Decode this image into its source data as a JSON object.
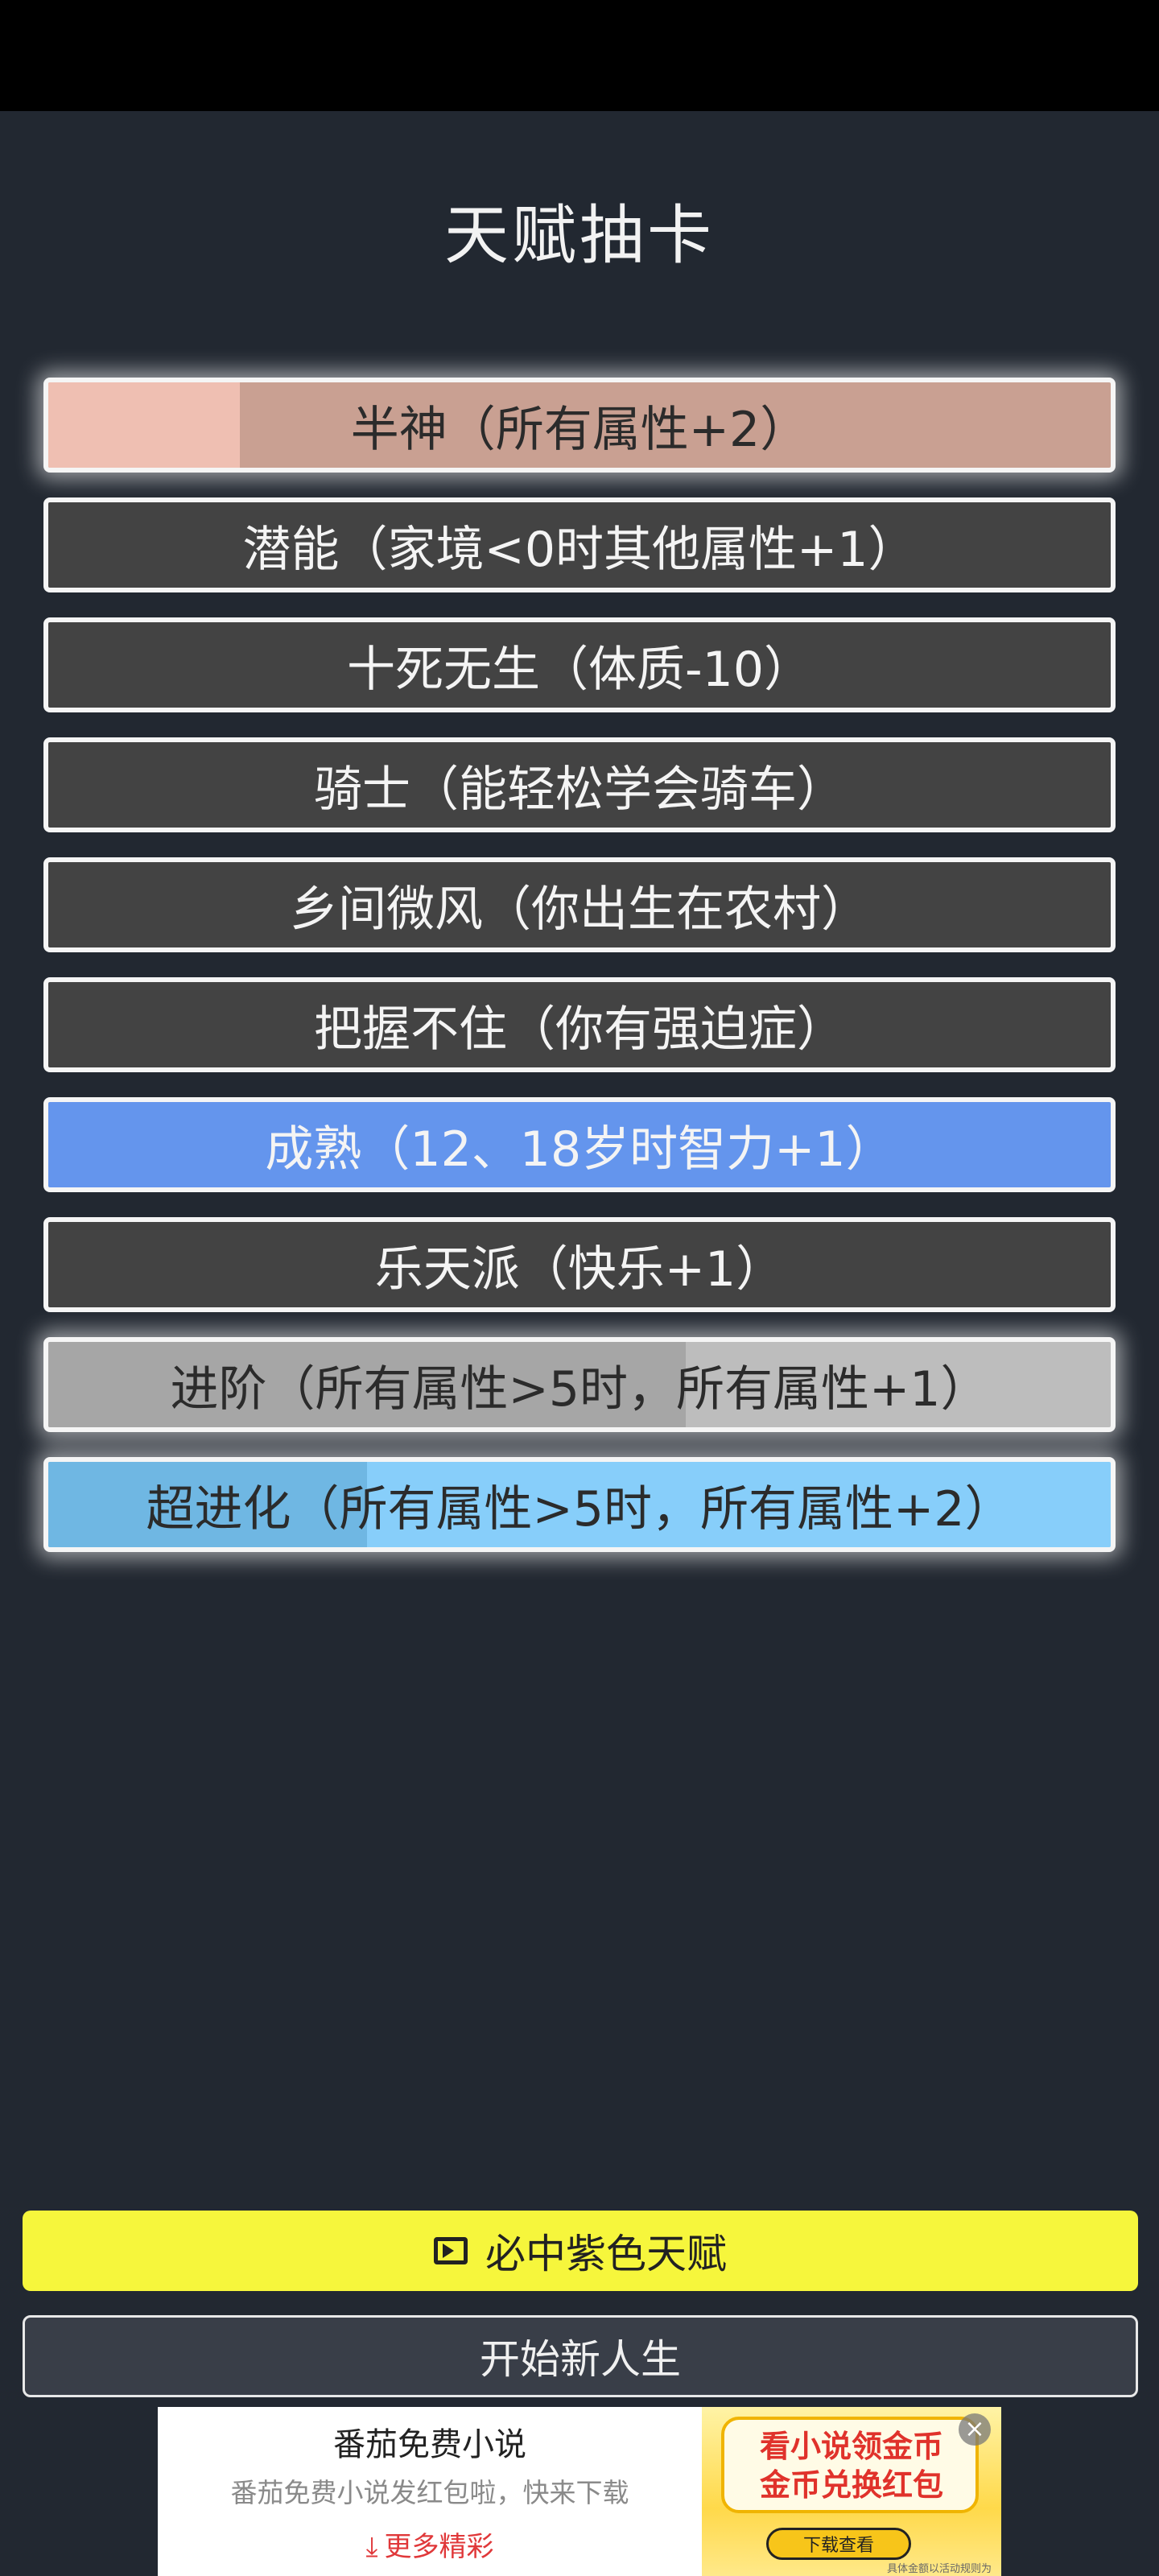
{
  "page": {
    "title": "天赋抽卡"
  },
  "talents": [
    {
      "label": "半神（所有属性+2）",
      "color": "#c9a092",
      "fill": 0.18,
      "fill_color": "#efbfb2",
      "selected": true,
      "dark_text": true
    },
    {
      "label": "潜能（家境<0时其他属性+1）",
      "color": "#434343",
      "fill": 0,
      "fill_color": "",
      "selected": false,
      "dark_text": false
    },
    {
      "label": "十死无生（体质-10）",
      "color": "#434343",
      "fill": 0,
      "fill_color": "",
      "selected": false,
      "dark_text": false
    },
    {
      "label": "骑士（能轻松学会骑车）",
      "color": "#434343",
      "fill": 0,
      "fill_color": "",
      "selected": false,
      "dark_text": false
    },
    {
      "label": "乡间微风（你出生在农村）",
      "color": "#434343",
      "fill": 0,
      "fill_color": "",
      "selected": false,
      "dark_text": false
    },
    {
      "label": "把握不住（你有强迫症）",
      "color": "#434343",
      "fill": 0,
      "fill_color": "",
      "selected": false,
      "dark_text": false
    },
    {
      "label": "成熟（12、18岁时智力+1）",
      "color": "#6495ed",
      "fill": 0,
      "fill_color": "",
      "selected": false,
      "dark_text": false
    },
    {
      "label": "乐天派（快乐+1）",
      "color": "#434343",
      "fill": 0,
      "fill_color": "",
      "selected": false,
      "dark_text": false
    },
    {
      "label": "进阶（所有属性>5时，所有属性+1）",
      "color": "#bdbdbd",
      "fill": 0.6,
      "fill_color": "#a6a6a6",
      "selected": true,
      "dark_text": true
    },
    {
      "label": "超进化（所有属性>5时，所有属性+2）",
      "color": "#87cefa",
      "fill": 0.3,
      "fill_color": "#6fb7e3",
      "selected": true,
      "dark_text": true
    }
  ],
  "buttons": {
    "purple_talent": "必中紫色天赋",
    "new_life": "开始新人生"
  },
  "ad": {
    "title": "番茄免费小说",
    "desc": "番茄免费小说发红包啦，快来下载",
    "more": "更多精彩",
    "banner_line1": "看小说领金币",
    "banner_line2": "金币兑换红包",
    "banner_button": "下载查看",
    "fine_print": "具体金额以活动规则为准"
  }
}
